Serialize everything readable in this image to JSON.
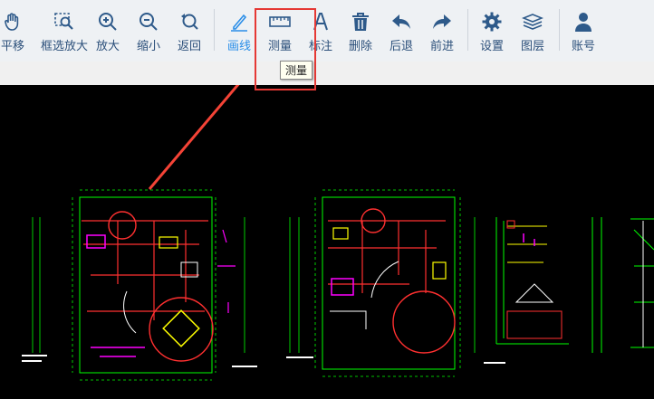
{
  "toolbar": {
    "tools": [
      {
        "label": "平移",
        "icon": "pan-hand-icon"
      },
      {
        "label": "框选放大",
        "icon": "box-zoom-icon"
      },
      {
        "label": "放大",
        "icon": "zoom-in-icon"
      },
      {
        "label": "缩小",
        "icon": "zoom-out-icon"
      },
      {
        "label": "返回",
        "icon": "zoom-back-icon"
      },
      {
        "label": "画线",
        "icon": "draw-line-icon"
      },
      {
        "label": "测量",
        "icon": "measure-ruler-icon"
      },
      {
        "label": "标注",
        "icon": "annotate-icon"
      },
      {
        "label": "删除",
        "icon": "trash-icon"
      },
      {
        "label": "后退",
        "icon": "undo-arrow-icon"
      },
      {
        "label": "前进",
        "icon": "redo-arrow-icon"
      },
      {
        "label": "设置",
        "icon": "gear-icon"
      },
      {
        "label": "图层",
        "icon": "layers-icon"
      },
      {
        "label": "账号",
        "icon": "user-icon"
      }
    ],
    "active_tool": "画线",
    "tooltip": "测量"
  },
  "colors": {
    "toolbar_bg": "#eef1f4",
    "icon": "#2e5a8a",
    "active": "#2a8ee8",
    "highlight": "#e53935",
    "canvas_bg": "#000000",
    "cad_green": "#00ff00",
    "cad_red": "#ff3030",
    "cad_magenta": "#ff00ff",
    "cad_yellow": "#ffff00"
  }
}
